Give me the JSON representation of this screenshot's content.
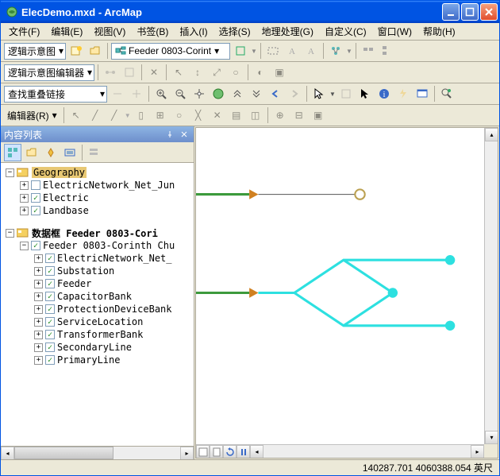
{
  "window": {
    "title": "ElecDemo.mxd - ArcMap"
  },
  "menu": {
    "items": [
      "文件(F)",
      "编辑(E)",
      "视图(V)",
      "书签(B)",
      "插入(I)",
      "选择(S)",
      "地理处理(G)",
      "自定义(C)",
      "窗口(W)",
      "帮助(H)"
    ]
  },
  "toolbar1": {
    "label": "逻辑示意图",
    "dropdown": "Feeder 0803-Corint"
  },
  "toolbar2": {
    "label": "逻辑示意图编辑器"
  },
  "toolbar3": {
    "dropdown": "查找重叠链接"
  },
  "toolbar4": {
    "button": "编辑器(R)"
  },
  "toc": {
    "title": "内容列表",
    "group1": {
      "label": "Geography",
      "items": [
        "ElectricNetwork_Net_Jun",
        "Electric",
        "Landbase"
      ]
    },
    "group2": {
      "label": "数据框 Feeder 0803-Cori",
      "sub": "Feeder 0803-Corinth Chu",
      "items": [
        "ElectricNetwork_Net_",
        "Substation",
        "Feeder",
        "CapacitorBank",
        "ProtectionDeviceBank",
        "ServiceLocation",
        "TransformerBank",
        "SecondaryLine",
        "PrimaryLine"
      ]
    }
  },
  "status": {
    "coords": "140287.701  4060388.054 英尺"
  }
}
